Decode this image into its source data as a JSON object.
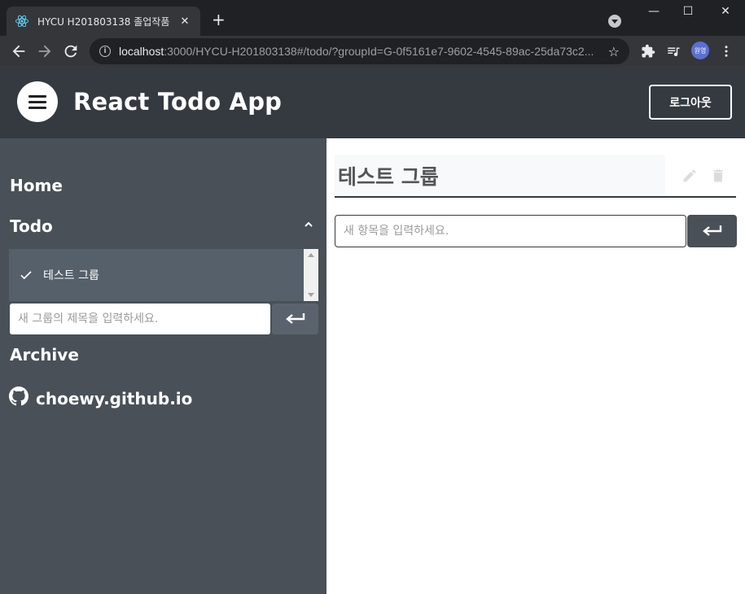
{
  "browser": {
    "tab_title": "HYCU H201803138 졸업작품",
    "tab_close": "✕",
    "new_tab": "+",
    "window_controls": [
      "—",
      "☐",
      "✕"
    ],
    "url_host": "localhost",
    "url_path": ":3000/HYCU-H201803138#/todo/?groupId=G-0f5161e7-9602-4545-89ac-25da73c2...",
    "profile_initials": "원영"
  },
  "app": {
    "title": "React Todo App",
    "logout_label": "로그아웃"
  },
  "sidebar": {
    "home_label": "Home",
    "todo_label": "Todo",
    "groups": [
      {
        "label": "테스트 그룹",
        "selected": true
      }
    ],
    "new_group_placeholder": "새 그룹의 제목을 입력하세요.",
    "archive_label": "Archive",
    "github_label": "choewy.github.io"
  },
  "main": {
    "group_title": "테스트 그룹",
    "new_item_placeholder": "새 항목을 입력하세요."
  },
  "colors": {
    "appbar": "#343a40",
    "sidebar": "#495057",
    "accent_button": "#495057"
  }
}
